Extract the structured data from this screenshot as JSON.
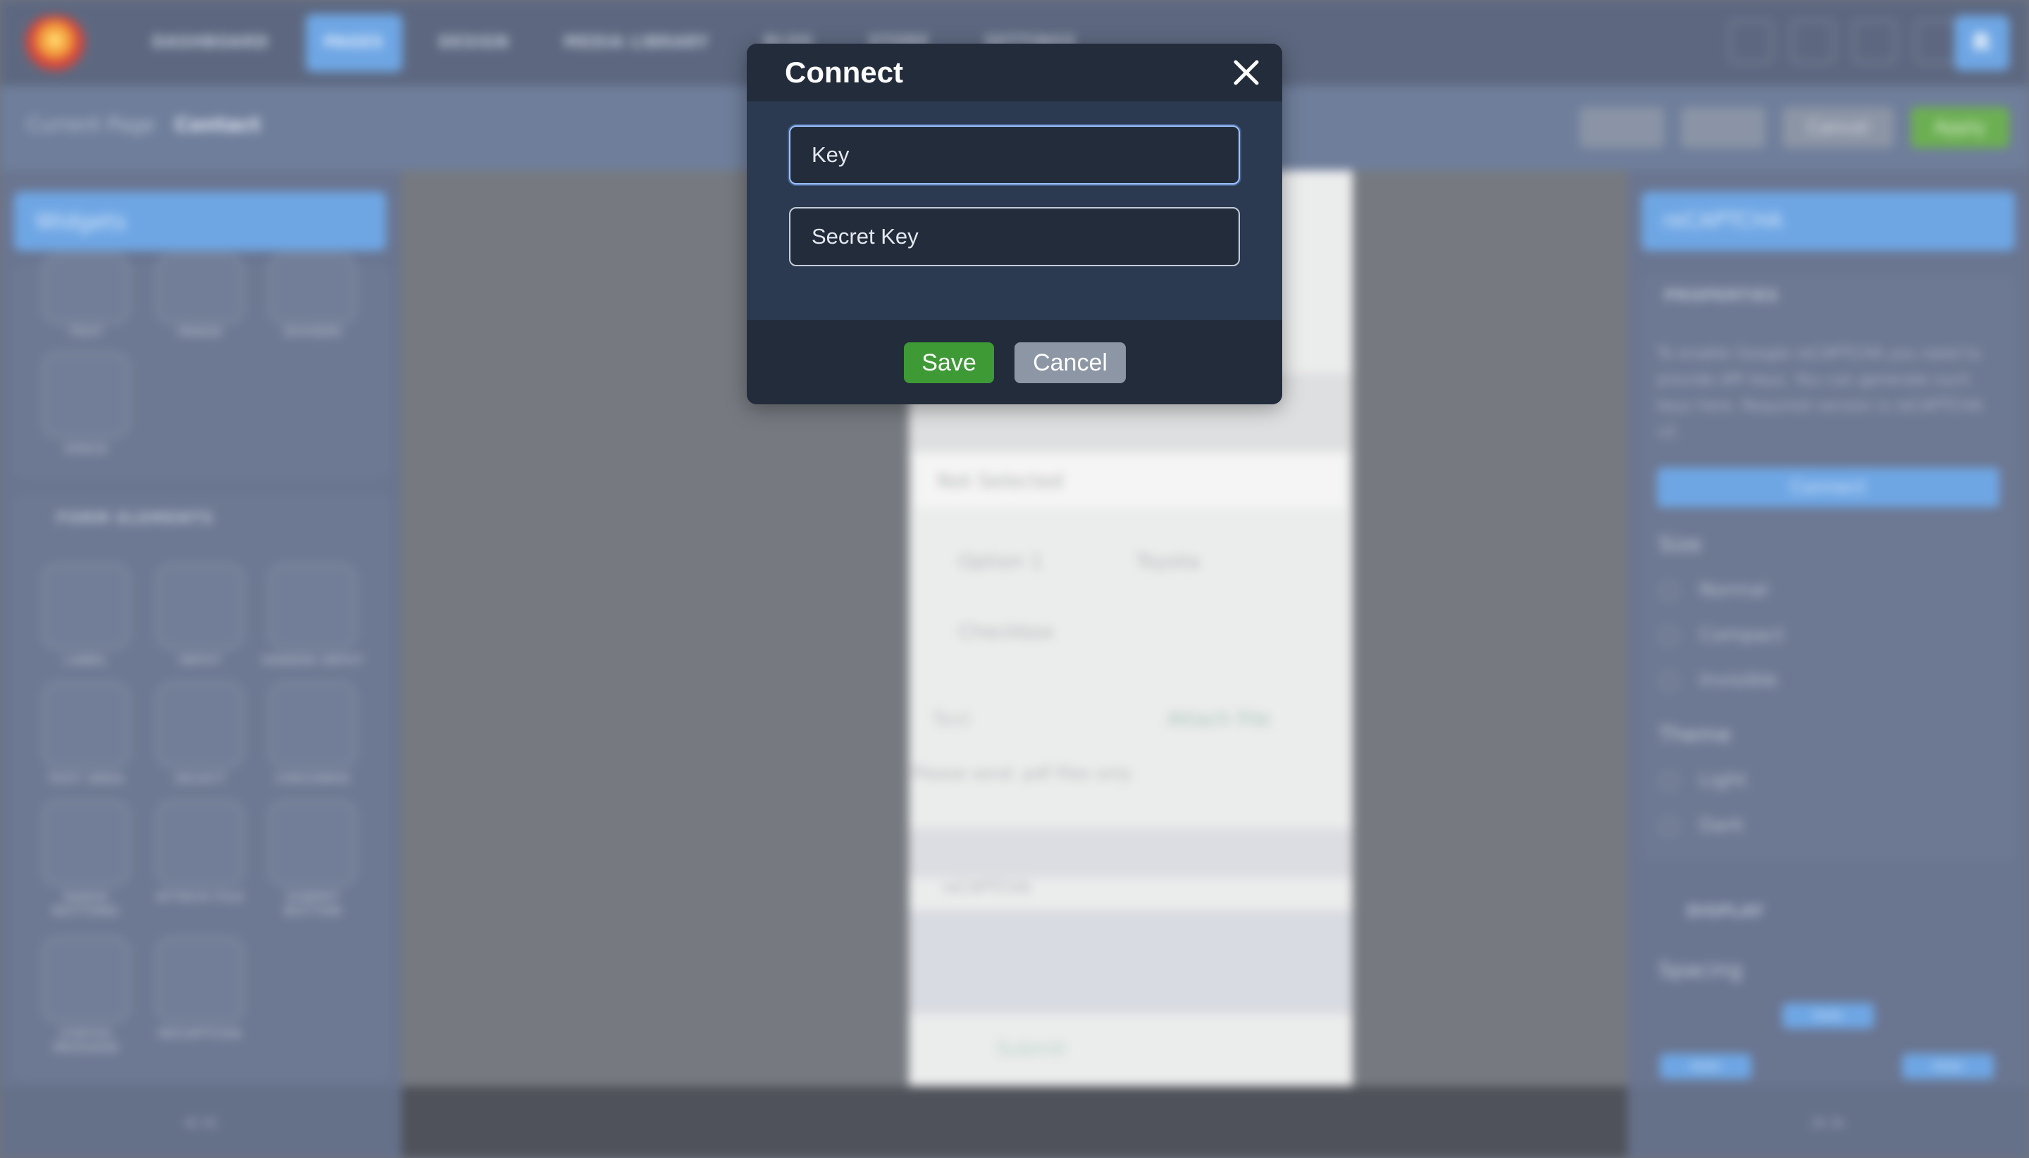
{
  "app": {
    "nav": [
      "DASHBOARD",
      "PAGES",
      "DESIGN",
      "MEDIA LIBRARY",
      "BLOG",
      "STORE",
      "SETTINGS"
    ],
    "active_nav": "PAGES",
    "user_initial": "R",
    "breadcrumb": {
      "label": "Current Page",
      "value": "Contact"
    },
    "actions": {
      "cancel": "Cancel",
      "apply": "Apply"
    }
  },
  "left_panel": {
    "title": "Widgets",
    "top_tiles": [
      "TEXT",
      "IMAGE",
      "DIVIDER",
      "SPACE"
    ],
    "form_section": "FORM ELEMENTS",
    "form_tiles": [
      "LABEL",
      "INPUT",
      "HIDDEN INPUT",
      "TEXT AREA",
      "SELECT",
      "CHECKBOX",
      "RADIO BUTTONS",
      "ATTACH FILE",
      "SUBMIT BUTTON",
      "STATUS MESSAGE",
      "RECAPTCHA"
    ],
    "collapse": "<<"
  },
  "canvas": {
    "select_value": "Not Selected",
    "option1": "Option 1",
    "option2": "Toyota",
    "checkbox": "Checkbox",
    "text_field": "Text",
    "attach": "Attach File",
    "hint": "Please send .pdf files only",
    "recaptcha_tag": "reCAPTCHA",
    "submit": "Submit"
  },
  "right_panel": {
    "title": "reCAPTCHA",
    "properties_title": "PROPERTIES",
    "description": "To enable Google reCAPTCHA you need to provide API keys. You can generate such keys here. Required version is reCAPTCHA v2.",
    "connect_button": "Connect",
    "size_label": "Size",
    "size_options": [
      "Normal",
      "Compact",
      "Invisible"
    ],
    "theme_label": "Theme",
    "theme_options": [
      "Light",
      "Dark"
    ],
    "display_title": "DISPLAY",
    "spacing_label": "Spacing",
    "spacing_value": "Auto",
    "expand": ">>"
  },
  "modal": {
    "title": "Connect",
    "key_placeholder": "Key",
    "secret_placeholder": "Secret Key",
    "save_label": "Save",
    "cancel_label": "Cancel"
  }
}
